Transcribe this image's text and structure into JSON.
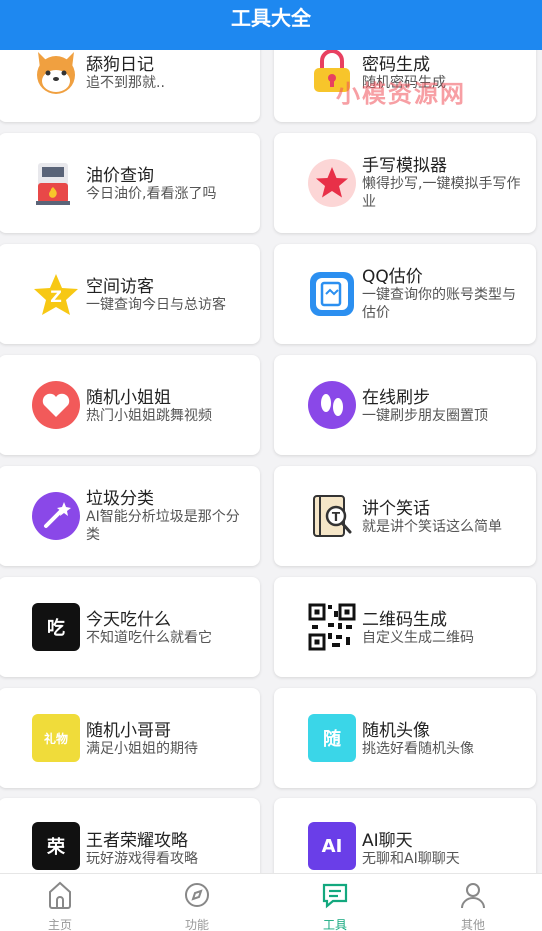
{
  "header": {
    "title": "工具大全"
  },
  "watermark": "小模资源网",
  "tools": [
    {
      "title": "舔狗日记",
      "sub": "追不到那就..",
      "icon": "shiba-dog-icon"
    },
    {
      "title": "密码生成",
      "sub": "随机密码生成",
      "icon": "lock-icon"
    },
    {
      "title": "油价查询",
      "sub": "今日油价,看看涨了吗",
      "icon": "gas-pump-icon"
    },
    {
      "title": "手写模拟器",
      "sub": "懒得抄写,一键模拟手写作业",
      "icon": "star-icon"
    },
    {
      "title": "空间访客",
      "sub": "一键查询今日与总访客",
      "icon": "qzone-star-icon"
    },
    {
      "title": "QQ估价",
      "sub": "一键查询你的账号类型与估价",
      "icon": "document-icon"
    },
    {
      "title": "随机小姐姐",
      "sub": "热门小姐姐跳舞视频",
      "icon": "heart-icon"
    },
    {
      "title": "在线刷步",
      "sub": "一键刷步朋友圈置顶",
      "icon": "footprint-icon"
    },
    {
      "title": "垃圾分类",
      "sub": "AI智能分析垃圾是那个分类",
      "icon": "magic-wand-icon"
    },
    {
      "title": "讲个笑话",
      "sub": "就是讲个笑话这么简单",
      "icon": "book-search-icon"
    },
    {
      "title": "今天吃什么",
      "sub": "不知道吃什么就看它",
      "icon": "eat-icon",
      "badge": "吃"
    },
    {
      "title": "二维码生成",
      "sub": "自定义生成二维码",
      "icon": "qr-code-icon"
    },
    {
      "title": "随机小哥哥",
      "sub": "满足小姐姐的期待",
      "icon": "gift-icon",
      "badge": "礼物"
    },
    {
      "title": "随机头像",
      "sub": "挑选好看随机头像",
      "icon": "random-icon",
      "badge": "随"
    },
    {
      "title": "王者荣耀攻略",
      "sub": "玩好游戏得看攻略",
      "icon": "glory-icon",
      "badge": "荣"
    },
    {
      "title": "AI聊天",
      "sub": "无聊和AI聊聊天",
      "icon": "ai-icon",
      "badge": "AI"
    }
  ],
  "nav": [
    {
      "label": "主页",
      "icon": "home-icon"
    },
    {
      "label": "功能",
      "icon": "compass-icon"
    },
    {
      "label": "工具",
      "icon": "chat-icon",
      "active": true
    },
    {
      "label": "其他",
      "icon": "user-icon"
    }
  ],
  "colors": {
    "primary": "#1e88f0",
    "active_nav": "#13a87e"
  }
}
